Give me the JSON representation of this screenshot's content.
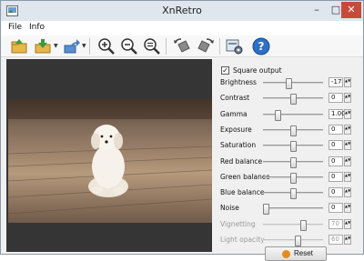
{
  "window": {
    "title": "XnRetro",
    "minimize": "–",
    "maximize": "□",
    "close": "✕"
  },
  "menu": {
    "items": [
      "File",
      "Info"
    ]
  },
  "toolbar": {
    "icons": [
      "open-icon",
      "save-icon",
      "export-icon",
      "zoom-in-icon",
      "zoom-out-icon",
      "zoom-fit-icon",
      "rotate-left-icon",
      "rotate-right-icon",
      "settings-icon",
      "help-icon"
    ]
  },
  "panel": {
    "square_output_label": "Square output",
    "square_output_checked": true,
    "check_mark": "✓",
    "arrows": "▲▼",
    "reset_label": "Reset",
    "rows": [
      {
        "label": "Brightness",
        "value": "-17",
        "level": 0.42,
        "enabled": true
      },
      {
        "label": "Contrast",
        "value": "0",
        "level": 0.5,
        "enabled": true
      },
      {
        "label": "Gamma",
        "value": "1.00",
        "level": 0.22,
        "enabled": true
      },
      {
        "label": "Exposure",
        "value": "0",
        "level": 0.5,
        "enabled": true
      },
      {
        "label": "Saturation",
        "value": "0",
        "level": 0.5,
        "enabled": true
      },
      {
        "label": "Red balance",
        "value": "0",
        "level": 0.5,
        "enabled": true
      },
      {
        "label": "Green balance",
        "value": "0",
        "level": 0.5,
        "enabled": true
      },
      {
        "label": "Blue balance",
        "value": "0",
        "level": 0.5,
        "enabled": true
      },
      {
        "label": "Noise",
        "value": "0",
        "level": 0.0,
        "enabled": true
      },
      {
        "label": "Vignetting",
        "value": "70",
        "level": 0.7,
        "enabled": false
      },
      {
        "label": "Light opacity",
        "value": "60",
        "level": 0.6,
        "enabled": false
      }
    ]
  }
}
